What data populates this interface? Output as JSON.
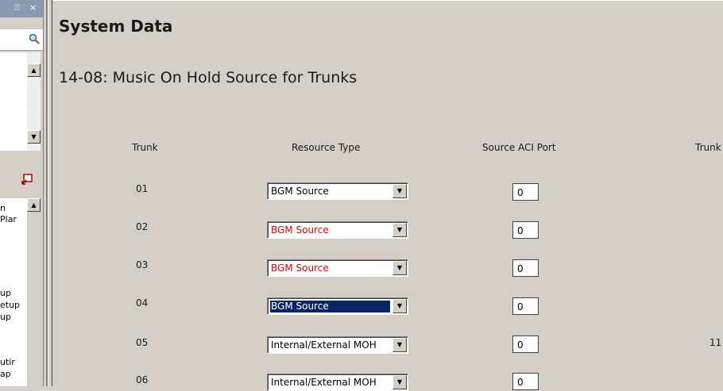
{
  "left_panel": {
    "pin_glyph": "⍐",
    "close_glyph": "×",
    "search_icon": "magnifier-icon",
    "items": [
      "n",
      "Plar",
      "up",
      "etup",
      "up",
      "utir",
      "ap"
    ]
  },
  "main": {
    "page_title": "System Data",
    "section_title": "14-08: Music On Hold Source for Trunks",
    "headers": {
      "trunk": "Trunk",
      "resource_type": "Resource Type",
      "source_port": "Source ACI Port",
      "trunk_right": "Trunk"
    },
    "rows": [
      {
        "trunk": "01",
        "resource_type": "BGM Source",
        "port": "0"
      },
      {
        "trunk": "02",
        "resource_type": "BGM Source",
        "port": "0"
      },
      {
        "trunk": "03",
        "resource_type": "BGM Source",
        "port": "0"
      },
      {
        "trunk": "04",
        "resource_type": "BGM Source",
        "port": "0"
      },
      {
        "trunk": "05",
        "resource_type": "Internal/External MOH",
        "port": "0"
      },
      {
        "trunk": "06",
        "resource_type": "Internal/External MOH",
        "port": "0"
      }
    ],
    "right_trunk_value": "11"
  },
  "colors": {
    "changed_text": "#e00000",
    "selection_bg": "#0a246a"
  }
}
